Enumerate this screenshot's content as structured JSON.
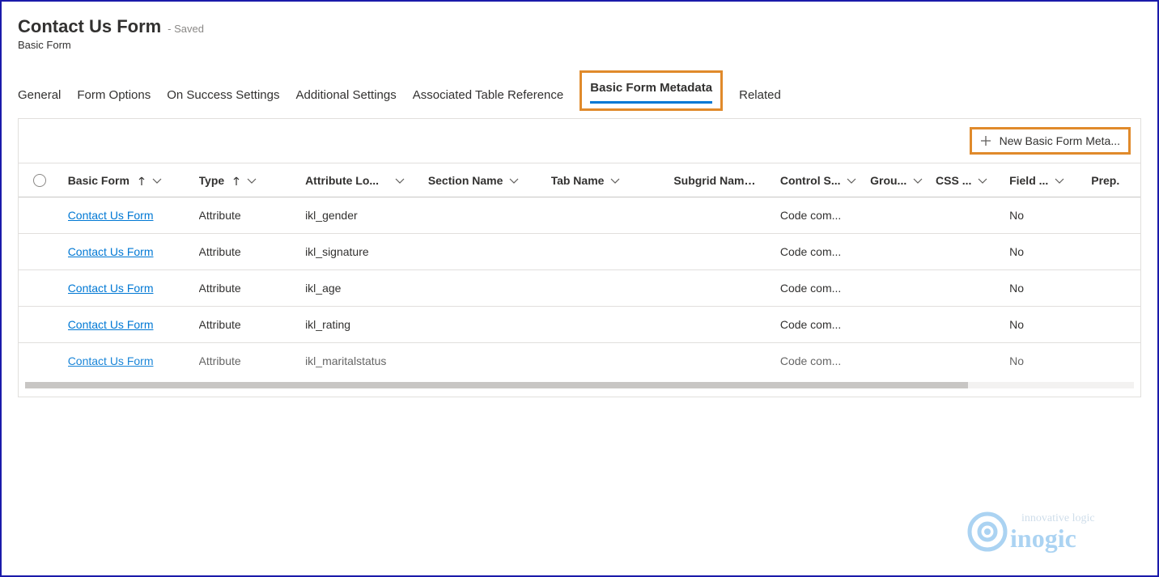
{
  "header": {
    "title": "Contact Us Form",
    "saved": "- Saved",
    "subtitle": "Basic Form"
  },
  "tabs": [
    {
      "label": "General",
      "active": false
    },
    {
      "label": "Form Options",
      "active": false
    },
    {
      "label": "On Success Settings",
      "active": false
    },
    {
      "label": "Additional Settings",
      "active": false
    },
    {
      "label": "Associated Table Reference",
      "active": false
    },
    {
      "label": "Basic Form Metadata",
      "active": true
    },
    {
      "label": "Related",
      "active": false
    }
  ],
  "toolbar": {
    "new_button": "New Basic Form Meta..."
  },
  "columns": {
    "basic_form": "Basic Form",
    "type": "Type",
    "attribute_logical": "Attribute Lo...",
    "section_name": "Section Name",
    "tab_name": "Tab Name",
    "subgrid_name": "Subgrid Name",
    "control_s": "Control S...",
    "group": "Grou...",
    "css": "CSS ...",
    "field": "Field ...",
    "prep": "Prep."
  },
  "rows": [
    {
      "basic_form": "Contact Us Form",
      "type": "Attribute",
      "attribute": "ikl_gender",
      "control": "Code com...",
      "field": "No"
    },
    {
      "basic_form": "Contact Us Form",
      "type": "Attribute",
      "attribute": "ikl_signature",
      "control": "Code com...",
      "field": "No"
    },
    {
      "basic_form": "Contact Us Form",
      "type": "Attribute",
      "attribute": "ikl_age",
      "control": "Code com...",
      "field": "No"
    },
    {
      "basic_form": "Contact Us Form",
      "type": "Attribute",
      "attribute": "ikl_rating",
      "control": "Code com...",
      "field": "No"
    },
    {
      "basic_form": "Contact Us Form",
      "type": "Attribute",
      "attribute": "ikl_maritalstatus",
      "control": "Code com...",
      "field": "No"
    }
  ],
  "watermark": {
    "tagline": "innovative logic",
    "brand": "inogic"
  }
}
